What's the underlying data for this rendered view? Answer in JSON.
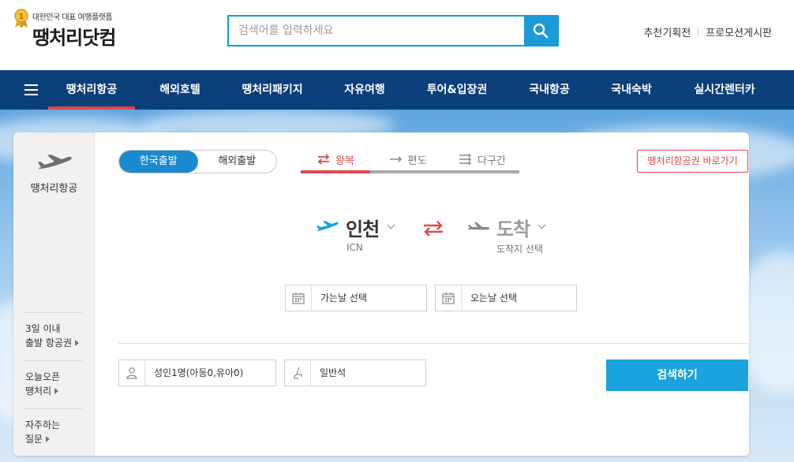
{
  "header": {
    "logo_tagline": "대한민국 대표 여행플랫폼",
    "logo_main": "땡처리",
    "logo_suffix": "닷컴",
    "search_placeholder": "검색어를 입력하세요",
    "top_links": [
      "추천기획전",
      "프로모션게시판"
    ]
  },
  "nav": {
    "items": [
      "땡처리항공",
      "해외호텔",
      "땡처리패키지",
      "자유여행",
      "투어&입장권",
      "국내항공",
      "국내숙박",
      "실시간렌터카"
    ],
    "active_index": 0
  },
  "sidebar": {
    "title": "땡처리항공",
    "links": [
      {
        "line1": "3일 이내",
        "line2": "출발 항공권"
      },
      {
        "line1": "오늘오픈",
        "line2": "땡처리"
      },
      {
        "line1": "자주하는",
        "line2": "질문"
      }
    ]
  },
  "booking": {
    "depart_options": [
      "한국출발",
      "해외출발"
    ],
    "trip_types": [
      "왕복",
      "편도",
      "다구간"
    ],
    "shortcut_label": "땡처리항공권 바로가기",
    "from_city": "인천",
    "from_code": "ICN",
    "to_city": "도착",
    "to_sub": "도착지 선택",
    "depart_date": "가는날 선택",
    "return_date": "오는날 선택",
    "passengers": "성인1명(아동0,유아0)",
    "seat_class": "일반석",
    "search_label": "검색하기"
  },
  "colors": {
    "brand_blue": "#1a9ad6",
    "nav_bg": "#0a3f7a",
    "accent_red": "#e0474c",
    "search_button": "#1aa3df"
  }
}
